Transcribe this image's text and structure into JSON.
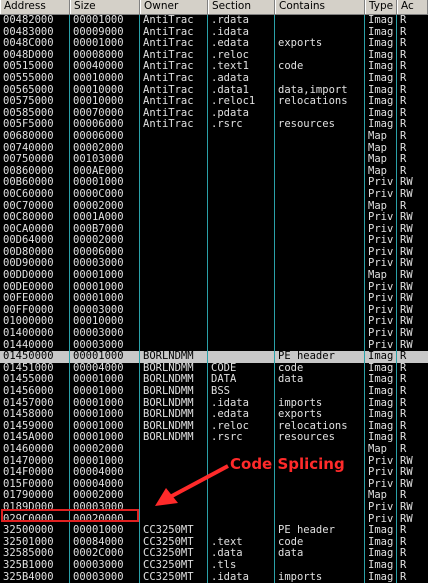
{
  "columns": [
    "Address",
    "Size",
    "Owner",
    "Section",
    "Contains",
    "Type",
    "Ac"
  ],
  "rows": [
    [
      "00482000",
      "00001000",
      "AntiTrac",
      ".rdata",
      "",
      "Imag",
      "R"
    ],
    [
      "00483000",
      "00009000",
      "AntiTrac",
      ".idata",
      "",
      "Imag",
      "R"
    ],
    [
      "0048C000",
      "00001000",
      "AntiTrac",
      ".edata",
      "exports",
      "Imag",
      "R"
    ],
    [
      "0048D000",
      "00008000",
      "AntiTrac",
      ".reloc",
      "",
      "Imag",
      "R"
    ],
    [
      "00515000",
      "00040000",
      "AntiTrac",
      ".text1",
      "code",
      "Imag",
      "R"
    ],
    [
      "00555000",
      "00010000",
      "AntiTrac",
      ".adata",
      "",
      "Imag",
      "R"
    ],
    [
      "00565000",
      "00010000",
      "AntiTrac",
      ".data1",
      "data,import",
      "Imag",
      "R"
    ],
    [
      "00575000",
      "00010000",
      "AntiTrac",
      ".reloc1",
      "relocations",
      "Imag",
      "R"
    ],
    [
      "00585000",
      "00070000",
      "AntiTrac",
      ".pdata",
      "",
      "Imag",
      "R"
    ],
    [
      "005F5000",
      "00006000",
      "AntiTrac",
      ".rsrc",
      "resources",
      "Imag",
      "R"
    ],
    [
      "00680000",
      "00006000",
      "",
      "",
      "",
      "Map",
      "R"
    ],
    [
      "00740000",
      "00002000",
      "",
      "",
      "",
      "Map",
      "R"
    ],
    [
      "00750000",
      "00103000",
      "",
      "",
      "",
      "Map",
      "R"
    ],
    [
      "00860000",
      "000AE000",
      "",
      "",
      "",
      "Map",
      "R"
    ],
    [
      "00B60000",
      "00001000",
      "",
      "",
      "",
      "Priv",
      "RW"
    ],
    [
      "00C60000",
      "0000C000",
      "",
      "",
      "",
      "Priv",
      "RW"
    ],
    [
      "00C70000",
      "00002000",
      "",
      "",
      "",
      "Map",
      "R"
    ],
    [
      "00C80000",
      "0001A000",
      "",
      "",
      "",
      "Priv",
      "RW"
    ],
    [
      "00CA0000",
      "000B7000",
      "",
      "",
      "",
      "Priv",
      "RW"
    ],
    [
      "00D64000",
      "00002000",
      "",
      "",
      "",
      "Priv",
      "RW"
    ],
    [
      "00D80000",
      "00006000",
      "",
      "",
      "",
      "Priv",
      "RW"
    ],
    [
      "00D90000",
      "00003000",
      "",
      "",
      "",
      "Priv",
      "RW"
    ],
    [
      "00DD0000",
      "00001000",
      "",
      "",
      "",
      "Map",
      "RW"
    ],
    [
      "00DE0000",
      "00001000",
      "",
      "",
      "",
      "Priv",
      "RW"
    ],
    [
      "00FE0000",
      "00001000",
      "",
      "",
      "",
      "Priv",
      "RW"
    ],
    [
      "00FF0000",
      "00003000",
      "",
      "",
      "",
      "Priv",
      "RW"
    ],
    [
      "01000000",
      "00010000",
      "",
      "",
      "",
      "Priv",
      "RW"
    ],
    [
      "01400000",
      "00003000",
      "",
      "",
      "",
      "Priv",
      "RW"
    ],
    [
      "01440000",
      "00003000",
      "",
      "",
      "",
      "Priv",
      "RW"
    ],
    [
      "01450000",
      "00001000",
      "BORLNDMM",
      "",
      "PE header",
      "Imag",
      "R"
    ],
    [
      "01451000",
      "00004000",
      "BORLNDMM",
      "CODE",
      "code",
      "Imag",
      "R"
    ],
    [
      "01455000",
      "00001000",
      "BORLNDMM",
      "DATA",
      "data",
      "Imag",
      "R"
    ],
    [
      "01456000",
      "00001000",
      "BORLNDMM",
      "BSS",
      "",
      "Imag",
      "R"
    ],
    [
      "01457000",
      "00001000",
      "BORLNDMM",
      ".idata",
      "imports",
      "Imag",
      "R"
    ],
    [
      "01458000",
      "00001000",
      "BORLNDMM",
      ".edata",
      "exports",
      "Imag",
      "R"
    ],
    [
      "01459000",
      "00001000",
      "BORLNDMM",
      ".reloc",
      "relocations",
      "Imag",
      "R"
    ],
    [
      "0145A000",
      "00001000",
      "BORLNDMM",
      ".rsrc",
      "resources",
      "Imag",
      "R"
    ],
    [
      "01460000",
      "00002000",
      "",
      "",
      "",
      "Map",
      "R"
    ],
    [
      "01470000",
      "00001000",
      "",
      "",
      "",
      "Priv",
      "RW"
    ],
    [
      "014F0000",
      "00004000",
      "",
      "",
      "",
      "Priv",
      "RW"
    ],
    [
      "015F0000",
      "00004000",
      "",
      "",
      "",
      "Priv",
      "RW"
    ],
    [
      "01790000",
      "00002000",
      "",
      "",
      "",
      "Map",
      "R"
    ],
    [
      "0189D000",
      "00003000",
      "",
      "",
      "",
      "Priv",
      "RW"
    ],
    [
      "029C0000",
      "00020000",
      "",
      "",
      "",
      "Priv",
      "RW"
    ],
    [
      "32500000",
      "00001000",
      "CC3250MT",
      "",
      "PE header",
      "Imag",
      "R"
    ],
    [
      "32501000",
      "00084000",
      "CC3250MT",
      ".text",
      "code",
      "Imag",
      "R"
    ],
    [
      "32585000",
      "0002C000",
      "CC3250MT",
      ".data",
      "data",
      "Imag",
      "R"
    ],
    [
      "325B1000",
      "00003000",
      "CC3250MT",
      ".tls",
      "",
      "Imag",
      "R"
    ],
    [
      "325B4000",
      "00003000",
      "CC3250MT",
      ".idata",
      "imports",
      "Imag",
      "R"
    ]
  ],
  "selected_row": 29,
  "highlighted_row": 43,
  "callout": "Code Splicing",
  "colors": {
    "accent": "#ff2a2a",
    "grid": "#2aa0a8",
    "selection": "#c8c8c8"
  }
}
